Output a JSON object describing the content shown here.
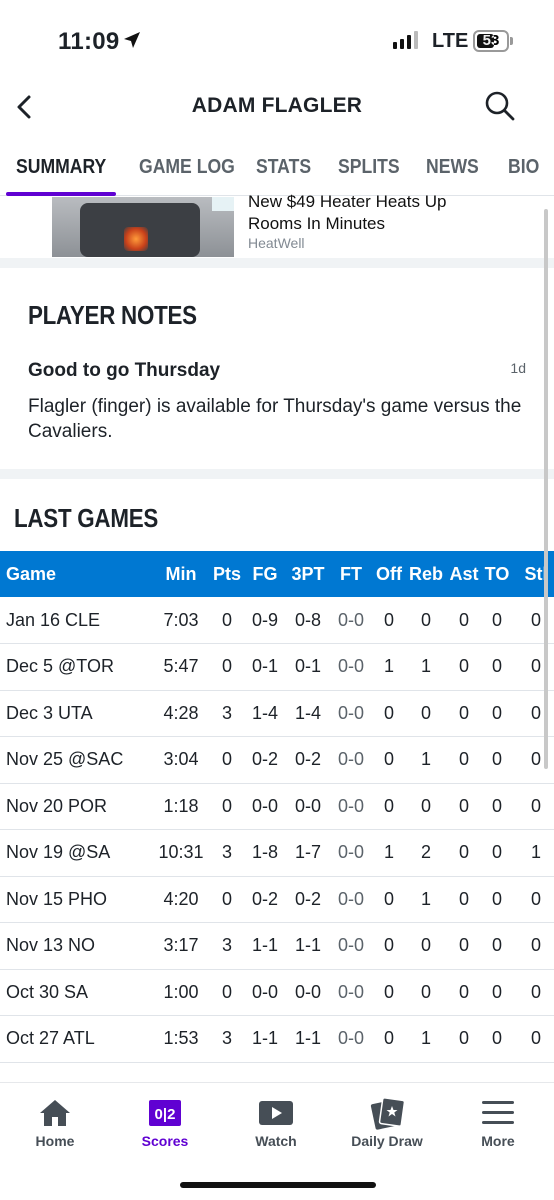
{
  "status": {
    "time": "11:09",
    "network": "LTE",
    "battery": "53"
  },
  "header": {
    "title": "ADAM FLAGLER"
  },
  "tabs": [
    "SUMMARY",
    "GAME LOG",
    "STATS",
    "SPLITS",
    "NEWS",
    "BIO"
  ],
  "ad": {
    "headline": "New $49 Heater Heats Up Rooms In Minutes",
    "source": "HeatWell"
  },
  "notes": {
    "title": "PLAYER NOTES",
    "headline": "Good to go Thursday",
    "age": "1d",
    "body": "Flagler (finger) is available for Thursday's game versus the Cavaliers."
  },
  "games": {
    "title": "LAST GAMES",
    "columns": [
      "Game",
      "Min",
      "Pts",
      "FG",
      "3PT",
      "FT",
      "Off",
      "Reb",
      "Ast",
      "TO",
      "Stl"
    ],
    "rows": [
      [
        "Jan 16 CLE",
        "7:03",
        "0",
        "0-9",
        "0-8",
        "0-0",
        "0",
        "0",
        "0",
        "0",
        "0"
      ],
      [
        "Dec 5 @TOR",
        "5:47",
        "0",
        "0-1",
        "0-1",
        "0-0",
        "1",
        "1",
        "0",
        "0",
        "0"
      ],
      [
        "Dec 3 UTA",
        "4:28",
        "3",
        "1-4",
        "1-4",
        "0-0",
        "0",
        "0",
        "0",
        "0",
        "0"
      ],
      [
        "Nov 25 @SAC",
        "3:04",
        "0",
        "0-2",
        "0-2",
        "0-0",
        "0",
        "1",
        "0",
        "0",
        "0"
      ],
      [
        "Nov 20 POR",
        "1:18",
        "0",
        "0-0",
        "0-0",
        "0-0",
        "0",
        "0",
        "0",
        "0",
        "0"
      ],
      [
        "Nov 19 @SA",
        "10:31",
        "3",
        "1-8",
        "1-7",
        "0-0",
        "1",
        "2",
        "0",
        "0",
        "1"
      ],
      [
        "Nov 15 PHO",
        "4:20",
        "0",
        "0-2",
        "0-2",
        "0-0",
        "0",
        "1",
        "0",
        "0",
        "0"
      ],
      [
        "Nov 13 NO",
        "3:17",
        "3",
        "1-1",
        "1-1",
        "0-0",
        "0",
        "0",
        "0",
        "0",
        "0"
      ],
      [
        "Oct 30 SA",
        "1:00",
        "0",
        "0-0",
        "0-0",
        "0-0",
        "0",
        "0",
        "0",
        "0",
        "0"
      ],
      [
        "Oct 27 ATL",
        "1:53",
        "3",
        "1-1",
        "1-1",
        "0-0",
        "0",
        "1",
        "0",
        "0",
        "0"
      ]
    ]
  },
  "tab_bar": [
    {
      "label": "Home",
      "icon": "home-icon"
    },
    {
      "label": "Scores",
      "icon": "scores-icon"
    },
    {
      "label": "Watch",
      "icon": "watch-icon"
    },
    {
      "label": "Daily Draw",
      "icon": "daily-draw-icon"
    },
    {
      "label": "More",
      "icon": "menu-icon"
    }
  ],
  "colors": {
    "accent": "#6001d2",
    "table_header": "#0078d2"
  }
}
